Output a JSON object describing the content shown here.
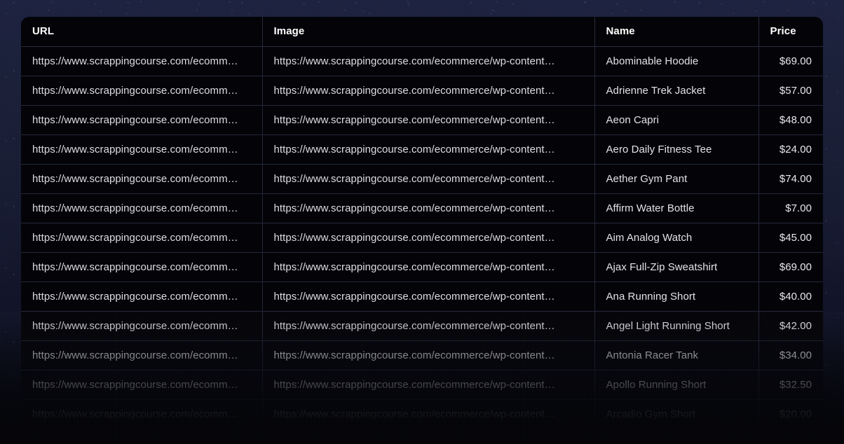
{
  "table": {
    "columns": [
      {
        "key": "url",
        "label": "URL",
        "align": "left"
      },
      {
        "key": "image",
        "label": "Image",
        "align": "left"
      },
      {
        "key": "name",
        "label": "Name",
        "align": "left"
      },
      {
        "key": "price",
        "label": "Price",
        "align": "left"
      }
    ],
    "url_cell_text": "https://www.scrappingcourse.com/ecomm…",
    "image_cell_text": "https://www.scrappingcourse.com/ecommerce/wp-content…",
    "rows": [
      {
        "url": "https://www.scrappingcourse.com/ecomm…",
        "image": "https://www.scrappingcourse.com/ecommerce/wp-content…",
        "name": "Abominable Hoodie",
        "price": "$69.00"
      },
      {
        "url": "https://www.scrappingcourse.com/ecomm…",
        "image": "https://www.scrappingcourse.com/ecommerce/wp-content…",
        "name": "Adrienne Trek Jacket",
        "price": "$57.00"
      },
      {
        "url": "https://www.scrappingcourse.com/ecomm…",
        "image": "https://www.scrappingcourse.com/ecommerce/wp-content…",
        "name": "Aeon Capri",
        "price": "$48.00"
      },
      {
        "url": "https://www.scrappingcourse.com/ecomm…",
        "image": "https://www.scrappingcourse.com/ecommerce/wp-content…",
        "name": "Aero Daily Fitness Tee",
        "price": "$24.00"
      },
      {
        "url": "https://www.scrappingcourse.com/ecomm…",
        "image": "https://www.scrappingcourse.com/ecommerce/wp-content…",
        "name": "Aether Gym Pant",
        "price": "$74.00"
      },
      {
        "url": "https://www.scrappingcourse.com/ecomm…",
        "image": "https://www.scrappingcourse.com/ecommerce/wp-content…",
        "name": "Affirm Water Bottle",
        "price": "$7.00"
      },
      {
        "url": "https://www.scrappingcourse.com/ecomm…",
        "image": "https://www.scrappingcourse.com/ecommerce/wp-content…",
        "name": "Aim Analog Watch",
        "price": "$45.00"
      },
      {
        "url": "https://www.scrappingcourse.com/ecomm…",
        "image": "https://www.scrappingcourse.com/ecommerce/wp-content…",
        "name": "Ajax Full-Zip Sweatshirt",
        "price": "$69.00"
      },
      {
        "url": "https://www.scrappingcourse.com/ecomm…",
        "image": "https://www.scrappingcourse.com/ecommerce/wp-content…",
        "name": "Ana Running Short",
        "price": "$40.00"
      },
      {
        "url": "https://www.scrappingcourse.com/ecomm…",
        "image": "https://www.scrappingcourse.com/ecommerce/wp-content…",
        "name": "Angel Light Running Short",
        "price": "$42.00"
      },
      {
        "url": "https://www.scrappingcourse.com/ecomm…",
        "image": "https://www.scrappingcourse.com/ecommerce/wp-content…",
        "name": "Antonia Racer Tank",
        "price": "$34.00"
      },
      {
        "url": "https://www.scrappingcourse.com/ecomm…",
        "image": "https://www.scrappingcourse.com/ecommerce/wp-content…",
        "name": "Apollo Running Short",
        "price": "$32.50"
      },
      {
        "url": "https://www.scrappingcourse.com/ecomm…",
        "image": "https://www.scrappingcourse.com/ecommerce/wp-content…",
        "name": "Arcadio Gym Short",
        "price": "$20.00"
      }
    ]
  },
  "colors": {
    "page_background": "#1d2240",
    "table_background": "#040408",
    "header_text": "#ffffff",
    "cell_text": "#dcdce2",
    "divider": "#23273a"
  }
}
